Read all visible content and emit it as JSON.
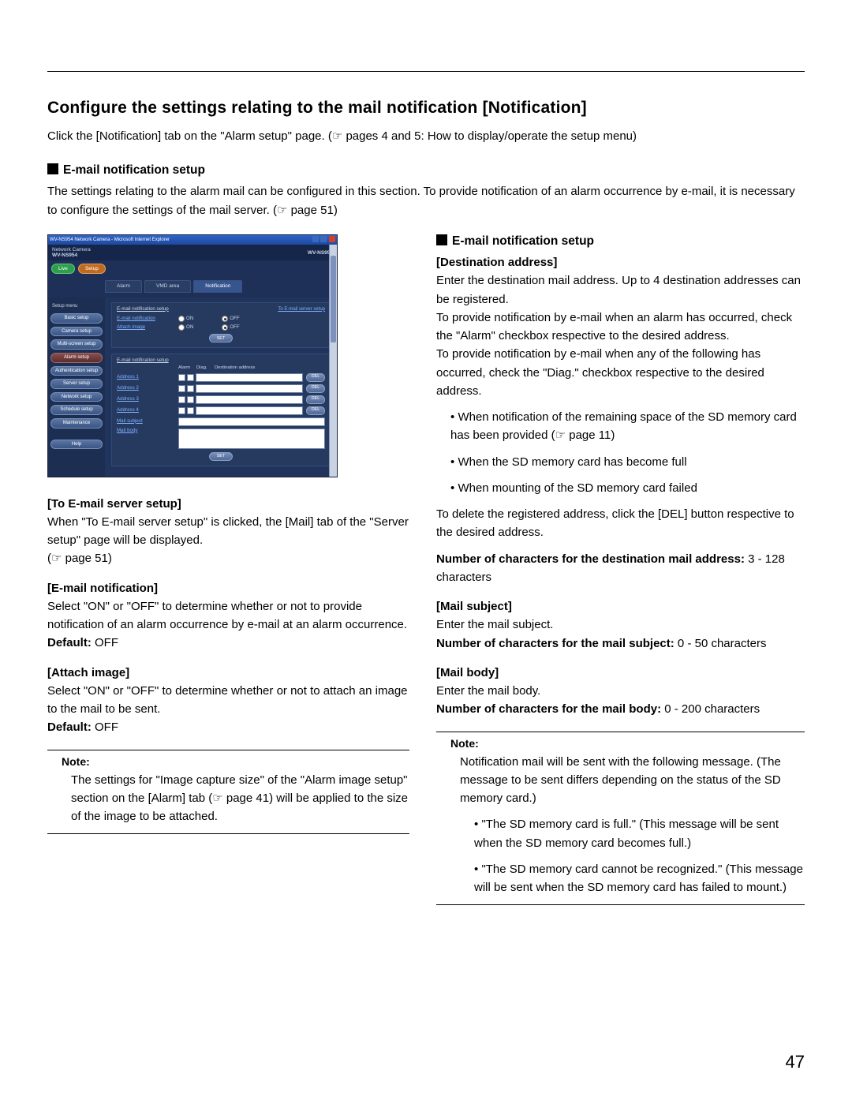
{
  "page_number": "47",
  "title": "Configure the settings relating to the mail notification [Notification]",
  "intro": "Click the [Notification] tab on the \"Alarm setup\" page. (☞ pages 4 and 5: How to display/operate the setup menu)",
  "section": {
    "head": "E-mail notification setup",
    "body": "The settings relating to the alarm mail can be configured in this section. To provide notification of an alarm occurrence by e-mail, it is necessary to configure the settings of the mail server. (☞ page 51)"
  },
  "left": {
    "to_server_label": "[To E-mail server setup]",
    "to_server_body": "When \"To E-mail server setup\" is clicked, the [Mail] tab of the \"Server setup\" page will be displayed.",
    "to_server_ref": "(☞ page 51)",
    "email_notif_label": "[E-mail notification]",
    "email_notif_body": "Select \"ON\" or \"OFF\" to determine whether or not to provide notification of an alarm occurrence by e-mail at an alarm occurrence.",
    "default1_label": "Default:",
    "default1_val": " OFF",
    "attach_label": "[Attach image]",
    "attach_body": "Select \"ON\" or \"OFF\" to determine whether or not to attach an image to the mail to be sent.",
    "default2_label": "Default:",
    "default2_val": " OFF",
    "note_label": "Note:",
    "note_body": "The settings for \"Image capture size\" of the \"Alarm image setup\" section on the [Alarm] tab (☞ page 41) will be applied to the size of the image to be attached."
  },
  "right": {
    "head": "E-mail notification setup",
    "dest_label": "[Destination address]",
    "dest_p1": "Enter the destination mail address. Up to 4 destination addresses can be registered.",
    "dest_p2": "To provide notification by e-mail when an alarm has occurred, check the \"Alarm\" checkbox respective to the desired address.",
    "dest_p3": "To provide notification by e-mail when any of the following has occurred, check the \"Diag.\" checkbox respective to the desired address.",
    "bul1": "When notification of the remaining space of the SD memory card has been provided (☞ page 11)",
    "bul2": "When the SD memory card has become full",
    "bul3": "When mounting of the SD memory card failed",
    "dest_p4": "To delete the registered address, click the [DEL] button respective to the desired address.",
    "num_dest_label": "Number of characters for the destination mail address:",
    "num_dest_val": " 3 - 128 characters",
    "subj_label": "[Mail subject]",
    "subj_body": "Enter the mail subject.",
    "num_subj_label": "Number of characters for the mail subject:",
    "num_subj_val": " 0 - 50 characters",
    "body_label": "[Mail body]",
    "body_body": "Enter the mail body.",
    "num_body_label": "Number of characters for the mail body:",
    "num_body_val": " 0 - 200 characters",
    "note_label": "Note:",
    "note_body": "Notification mail will be sent with the following message. (The message to be sent differs depending on the status of the SD memory card.)",
    "note_b1": "\"The SD memory card is full.\" (This message will be sent when the SD memory card becomes full.)",
    "note_b2": "\"The SD memory card cannot be recognized.\" (This message will be sent when the SD memory card has failed to mount.)"
  },
  "shot": {
    "titlebar": "WV-NS954 Network Camera - Microsoft Internet Explorer",
    "brand_line": "Network Camera",
    "model": "WV-NS954",
    "btn_live": "Live",
    "btn_setup": "Setup",
    "tabs": {
      "alarm": "Alarm",
      "vmd": "VMD area",
      "notif": "Notification"
    },
    "side_title": "Setup menu",
    "side": {
      "basic": "Basic setup",
      "camera": "Camera setup",
      "multi": "Multi-screen setup",
      "alarm": "Alarm setup",
      "auth": "Authentication setup",
      "server": "Server setup",
      "network": "Network setup",
      "schedule": "Schedule setup",
      "maint": "Maintenance",
      "help": "Help"
    },
    "g1": {
      "head": "E-mail notification setup",
      "link": "To E-mail server setup",
      "row1": "E-mail notification",
      "row2": "Attach image",
      "on": "ON",
      "off": "OFF",
      "set": "SET"
    },
    "g2": {
      "head": "E-mail notification setup",
      "col_alarm": "Alarm",
      "col_diag": "Diag.",
      "col_dest": "Destination address",
      "a1": "Address 1",
      "a2": "Address 2",
      "a3": "Address 3",
      "a4": "Address 4",
      "del": "DEL",
      "subj": "Mail subject",
      "body": "Mail body",
      "set": "SET"
    }
  }
}
